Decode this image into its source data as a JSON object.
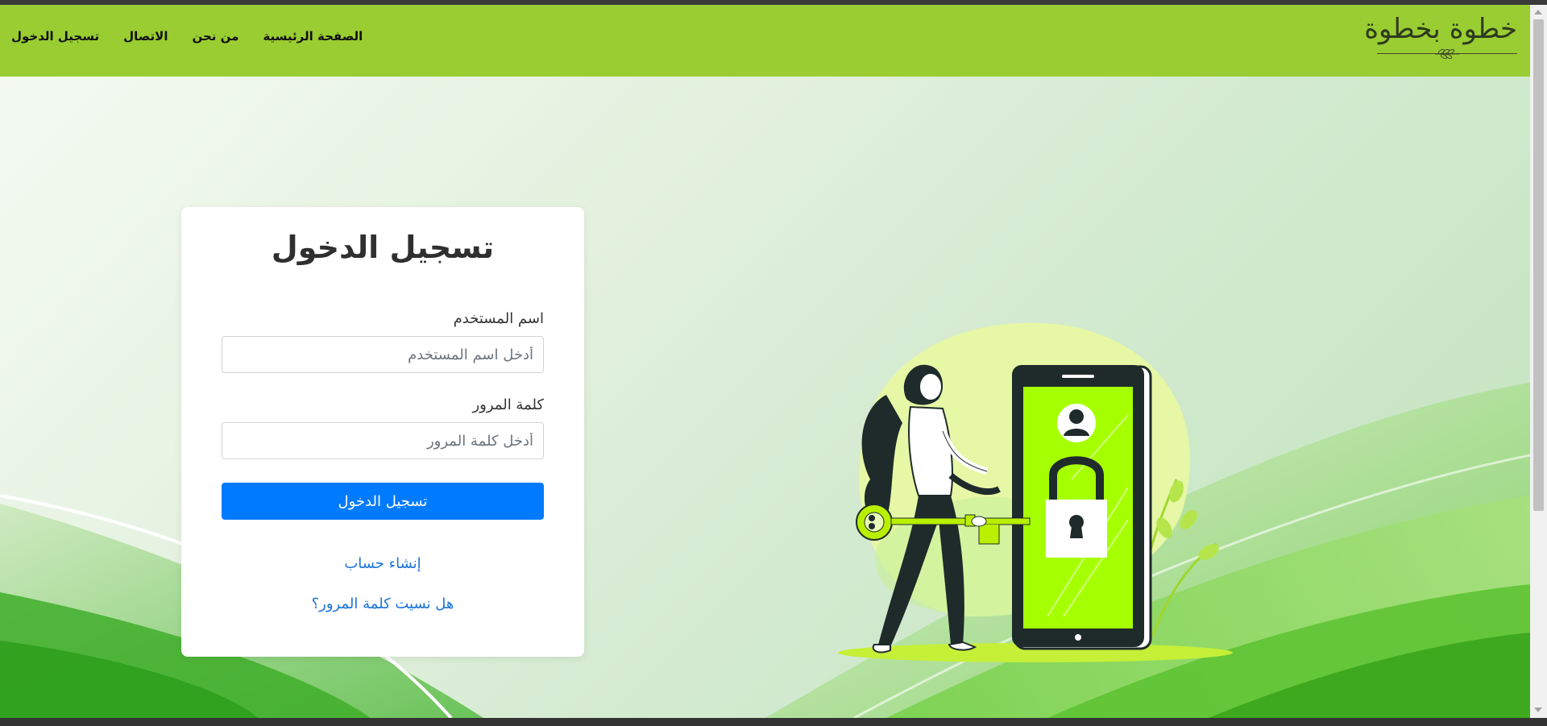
{
  "brand": {
    "logo_text": "خطوة بخطوة"
  },
  "nav": {
    "items": [
      {
        "label": "الصفحة الرئيسية"
      },
      {
        "label": "من نحن"
      },
      {
        "label": "الاتصال"
      },
      {
        "label": "تسجيل الدخول"
      }
    ]
  },
  "login": {
    "title": "تسجيل الدخول",
    "username_label": "اسم المستخدم",
    "username_placeholder": "أدخل اسم المستخدم",
    "password_label": "كلمة المرور",
    "password_placeholder": "أدخل كلمة المرور",
    "submit_label": "تسجيل الدخول",
    "create_account": "إنشاء حساب",
    "forgot_password": "هل نسيت كلمة المرور؟"
  },
  "colors": {
    "navbar": "#9acd32",
    "primary_button": "#007bff",
    "link": "#1a73d9",
    "phone_screen": "#a6ff00"
  }
}
